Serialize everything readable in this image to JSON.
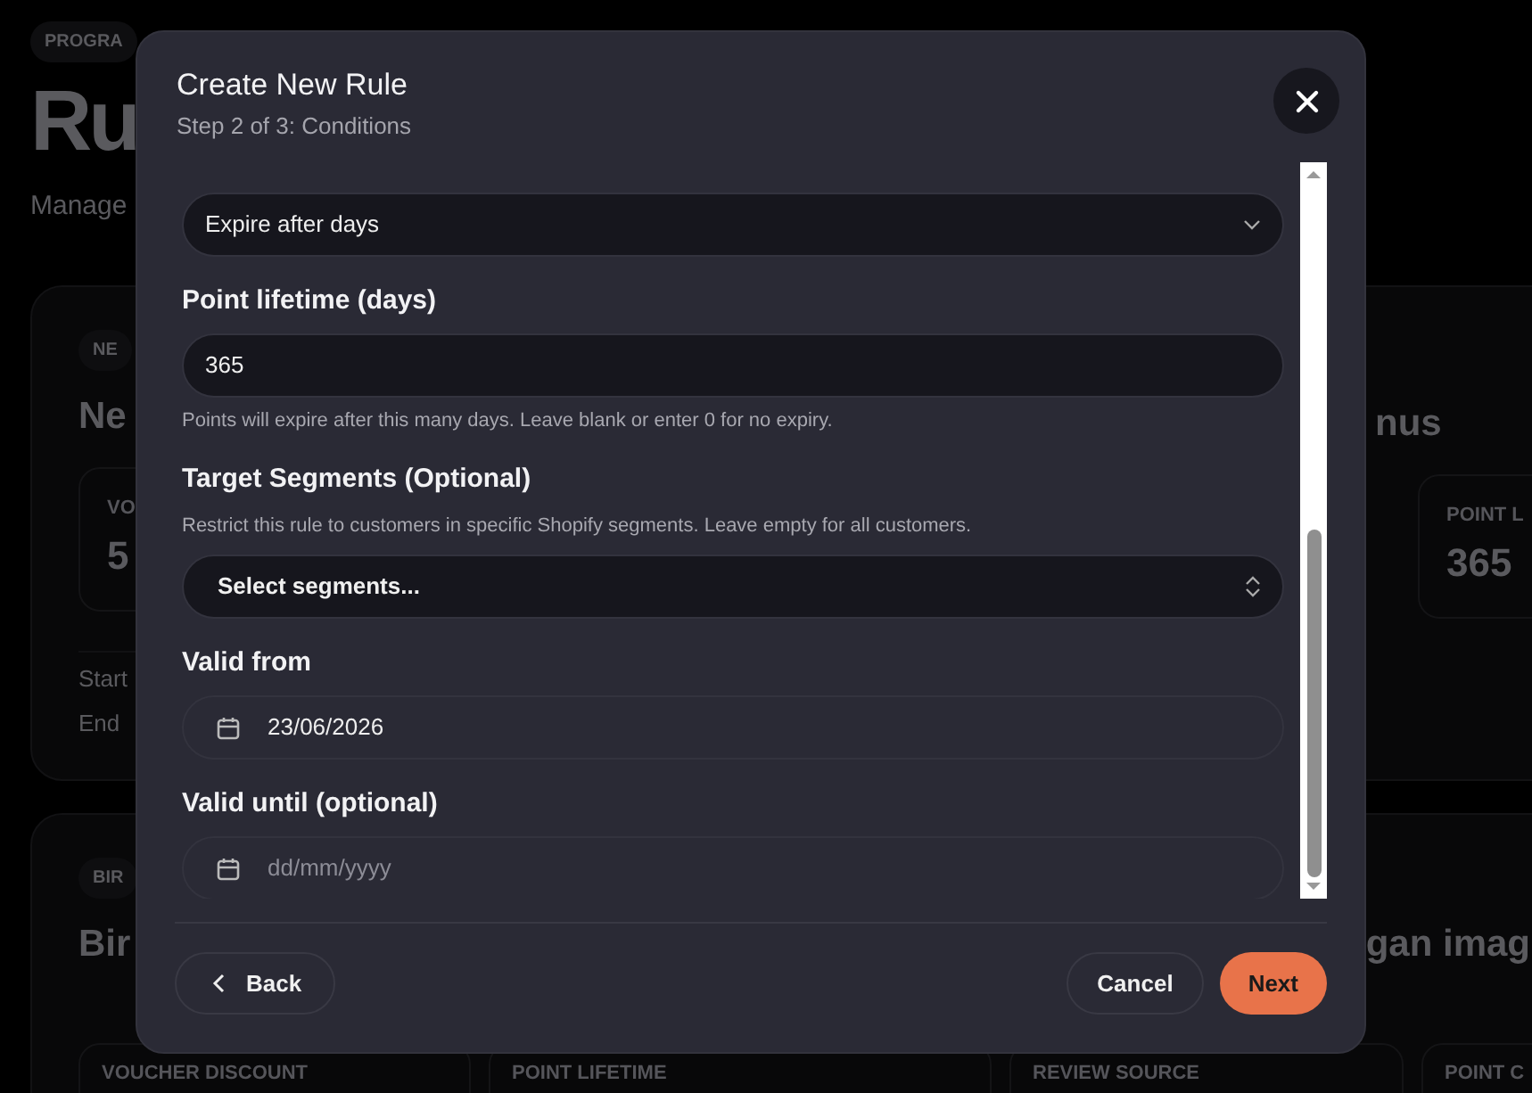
{
  "background": {
    "badge": "PROGRA",
    "heading": "Ru",
    "description": "Manage",
    "rule_cards": [
      {
        "badge": "NE",
        "title_start": "Ne",
        "title_end": "nus",
        "stats_left": [
          {
            "label": "VO",
            "value": "5"
          }
        ],
        "stats_right": [
          {
            "label": "POINT L",
            "value": "365"
          }
        ],
        "details": [
          "Start",
          "End"
        ]
      },
      {
        "badge": "BIR",
        "title_start": "Bir",
        "title_end": "gan imag",
        "stats": [
          {
            "label": "VOUCHER DISCOUNT"
          },
          {
            "label": "POINT LIFETIME"
          },
          {
            "label": "REVIEW SOURCE"
          },
          {
            "label": "POINT C"
          }
        ]
      }
    ]
  },
  "modal": {
    "title": "Create New Rule",
    "subtitle": "Step 2 of 3: Conditions",
    "fields": [
      {
        "kind": "select",
        "value": "Expire after days"
      },
      {
        "kind": "number",
        "label": "Point lifetime (days)",
        "value": "365",
        "help": "Points will expire after this many days. Leave blank or enter 0 for no expiry."
      },
      {
        "kind": "multiselect",
        "label": "Target Segments (Optional)",
        "help": "Restrict this rule to customers in specific Shopify segments. Leave empty for all customers.",
        "value": "Select segments..."
      },
      {
        "kind": "date",
        "label": "Valid from",
        "value": "23/06/2026"
      },
      {
        "kind": "date",
        "label": "Valid until (optional)",
        "placeholder": "dd/mm/yyyy"
      }
    ],
    "buttons": [
      {
        "kind": "back",
        "label": "Back"
      },
      {
        "kind": "secondary",
        "label": "Cancel"
      },
      {
        "kind": "primary",
        "label": "Next"
      }
    ]
  }
}
